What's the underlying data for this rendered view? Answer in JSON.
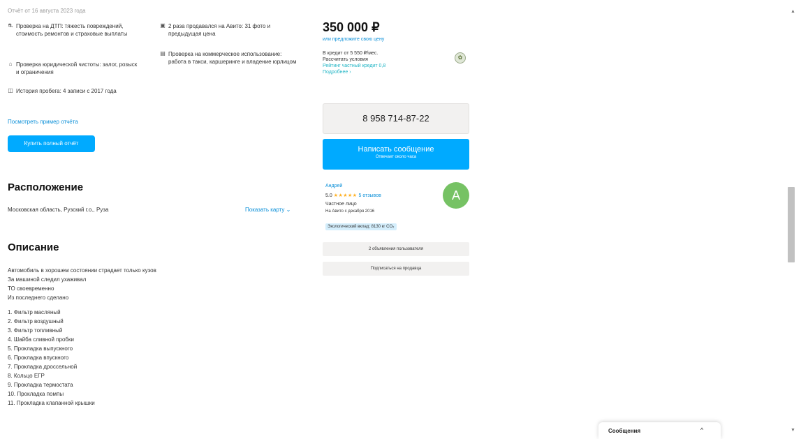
{
  "report": {
    "date": "Отчёт от 16 августа 2023 года",
    "features": [
      {
        "icon": "car-crash-icon",
        "text": "Проверка на ДТП: тяжесть повреждений, стоимость ремонтов и страховые выплаты"
      },
      {
        "icon": "bank-icon",
        "text": "Проверка юридической чистоты: залог, розыск и ограничения"
      },
      {
        "icon": "gauge-icon",
        "text": "История пробега: 4 записи с 2017 года"
      },
      {
        "icon": "ad-icon",
        "text": "2 раза продавался на Авито: 31 фото и предыдущая цена"
      },
      {
        "icon": "taxi-icon",
        "text": "Проверка на коммерческое использование: работа в такси, каршеринге и владение юрлицом"
      }
    ],
    "sample_link": "Посмотреть пример отчёта",
    "full_report_button": "Купить полный отчёт"
  },
  "location": {
    "title": "Расположение",
    "address": "Московская область, Рузский г.о., Руза",
    "map_link": "Показать карту"
  },
  "description": {
    "title": "Описание",
    "lines": [
      "Автомобиль в хорошем состоянии страдает только кузов",
      "За машиной следил ухаживал",
      "ТО своевременно",
      "Из последнего сделано"
    ],
    "list": [
      "1. Фильтр масляный",
      "2. Фильтр воздушный",
      "3. Фильтр топливный",
      "4. Шайба сливной пробки",
      "5. Прокладка выпускного",
      "6. Прокладка впускного",
      "7. Прокладка дроссельной",
      "8. Кольцо ЕГР",
      "9. Прокладка термостата",
      "10. Прокладка помпы",
      "11. Прокладка клапанной крышки"
    ]
  },
  "listing": {
    "price": "350 000 ₽",
    "offer_link": "или предложите свою цену",
    "credit_line": "В кредит от 5 550 ₽/мес.",
    "calc_link": "Рассчитать условия",
    "partner_link": "Рейтинг частный кредит 0,8",
    "more_link": "Подробнее",
    "credit_logo_glyph": "✿",
    "phone": "8 958 714-87-22",
    "message_button": "Написать сообщение",
    "message_sub": "Отвечает около часа",
    "seller": {
      "name": "Андрей",
      "rating": "5.0",
      "stars": "★★★★★",
      "reviews": "5 отзывов",
      "type": "Частное лицо",
      "since": "На Авито с декабря 2016",
      "eco_badge": "Экологический вклад: 8130 кг CO₂",
      "avatar_letter": "A",
      "avatar_color": "#76c264"
    },
    "user_ads_button": "2 объявления пользователя",
    "subscribe_button": "Подписаться на продавца"
  },
  "messenger": {
    "label": "Сообщения",
    "chevron": "^"
  },
  "scrollbar": {
    "up": "▲",
    "down": "▼"
  },
  "colors": {
    "accent": "#00aaff",
    "link": "#0a8fd8",
    "button_gray": "#f2f1f0"
  }
}
